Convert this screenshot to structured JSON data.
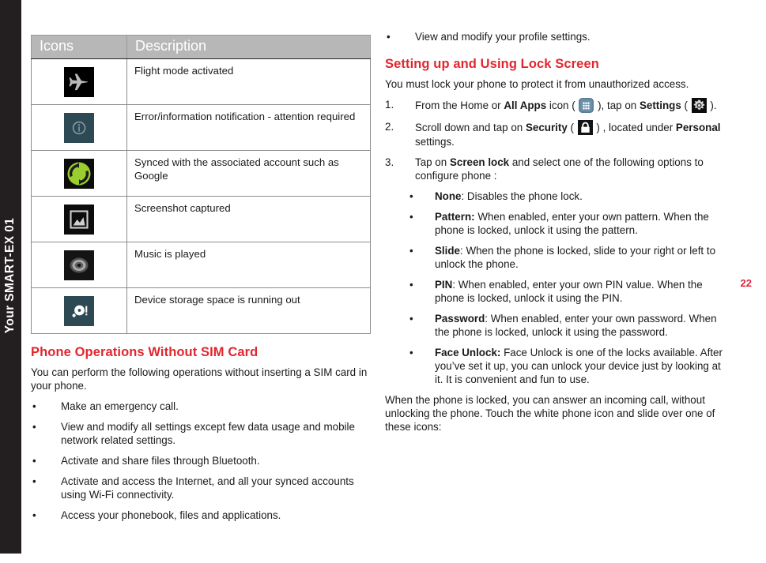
{
  "spine": {
    "label": "Your SMART-EX 01"
  },
  "page": {
    "number": "22"
  },
  "colors": {
    "accent_red": "#e1262f",
    "page_number_red": "#e1253a",
    "table_header_gray": "#b7b7b7",
    "spine_black": "#231f20",
    "info_icon_bg": "#2d4a54",
    "sync_icon_green": "#9ace2e",
    "allapps_icon_bg": "#5a7d94"
  },
  "icon_table": {
    "headers": {
      "icons": "Icons",
      "description": "Description"
    },
    "rows": [
      {
        "icon": "airplane-mode-icon",
        "description": "Flight mode activated"
      },
      {
        "icon": "info-notification-icon",
        "description": "Error/information notification -  attention required"
      },
      {
        "icon": "sync-icon",
        "description": "Synced with the associated account such as Google"
      },
      {
        "icon": "screenshot-icon",
        "description": "Screenshot captured"
      },
      {
        "icon": "music-disc-icon",
        "description": "Music is played"
      },
      {
        "icon": "storage-warning-icon",
        "description": "Device storage space is running out"
      }
    ]
  },
  "left_column": {
    "heading": "Phone Operations Without SIM Card",
    "intro": "You can perform the following operations without inserting a SIM card in your phone.",
    "bullets": [
      "Make an emergency call.",
      "View and modify all settings except few data usage and mobile network related settings.",
      "Activate and share files through Bluetooth.",
      "Activate and access the Internet, and all your synced accounts using Wi-Fi connectivity.",
      "Access your phonebook, files and applications."
    ],
    "bullet_char": "•"
  },
  "right_column": {
    "top_bullet": "View and modify your profile settings.",
    "heading": "Setting up and Using Lock Screen",
    "intro": "You must lock your phone to protect it from unauthorized access.",
    "steps": [
      {
        "number": "1.",
        "parts": [
          {
            "text": "From the Home or "
          },
          {
            "text": "All Apps",
            "bold": true
          },
          {
            "text": " icon ( "
          },
          {
            "icon": "all-apps-icon"
          },
          {
            "text": " ), tap on "
          },
          {
            "text": "Settings",
            "bold": true
          },
          {
            "text": " ( "
          },
          {
            "icon": "settings-gear-icon"
          },
          {
            "text": " )."
          }
        ]
      },
      {
        "number": "2.",
        "parts": [
          {
            "text": "Scroll down and tap on "
          },
          {
            "text": "Security",
            "bold": true
          },
          {
            "text": " ( "
          },
          {
            "icon": "lock-icon"
          },
          {
            "text": " ) , located under "
          },
          {
            "text": "Personal",
            "bold": true
          },
          {
            "text": " settings."
          }
        ]
      },
      {
        "number": "3.",
        "parts": [
          {
            "text": "Tap on "
          },
          {
            "text": "Screen lock",
            "bold": true
          },
          {
            "text": " and select one of the following options to configure phone :"
          }
        ]
      }
    ],
    "lock_options": [
      {
        "term": "None",
        "text": ": Disables the phone lock."
      },
      {
        "term": "Pattern:",
        "text": " When enabled, enter your own pattern. When the phone is locked, unlock it using the pattern."
      },
      {
        "term": "Slide",
        "text": ": When the phone is locked, slide to your right or left to unlock the phone."
      },
      {
        "term": "PIN",
        "text": ": When enabled, enter your own PIN value. When the phone is locked, unlock it using the PIN."
      },
      {
        "term": "Password",
        "text": ": When enabled, enter your own password. When the phone is locked, unlock it using the password."
      },
      {
        "term": "Face Unlock:",
        "text": " Face Unlock is one of the locks available. After you’ve set it up, you can unlock your device just by looking at it. It is convenient and fun to use."
      }
    ],
    "closing": "When the phone is locked, you can answer an incoming call, without unlocking the phone. Touch the white phone icon and slide over one of these icons:",
    "bullet_char": "•"
  }
}
